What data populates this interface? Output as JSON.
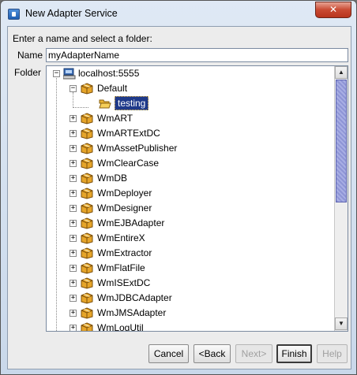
{
  "window": {
    "title": "New Adapter Service",
    "close_glyph": "✕",
    "icon": "app-icon"
  },
  "form": {
    "prompt": "Enter a name and select a folder:",
    "name_label": "Name",
    "name_value": "myAdapterName",
    "folder_label": "Folder"
  },
  "tree": {
    "root": {
      "label": "localhost:5555",
      "icon": "server-icon",
      "expanded": true
    },
    "default_node": {
      "label": "Default",
      "icon": "package-icon",
      "expanded": true
    },
    "selected_folder": {
      "label": "testing",
      "icon": "open-folder-icon"
    },
    "packages": [
      "WmART",
      "WmARTExtDC",
      "WmAssetPublisher",
      "WmClearCase",
      "WmDB",
      "WmDeployer",
      "WmDesigner",
      "WmEJBAdapter",
      "WmEntireX",
      "WmExtractor",
      "WmFlatFile",
      "WmISExtDC",
      "WmJDBCAdapter",
      "WmJMSAdapter",
      "WmLogUtil"
    ],
    "expand_glyph": "+",
    "collapse_glyph": "−"
  },
  "buttons": {
    "cancel": "Cancel",
    "back": "<Back",
    "next": "Next>",
    "finish": "Finish",
    "help": "Help"
  },
  "colors": {
    "selection": "#1f3a8a",
    "package": "#e0a020",
    "folder": "#f2c44a"
  }
}
